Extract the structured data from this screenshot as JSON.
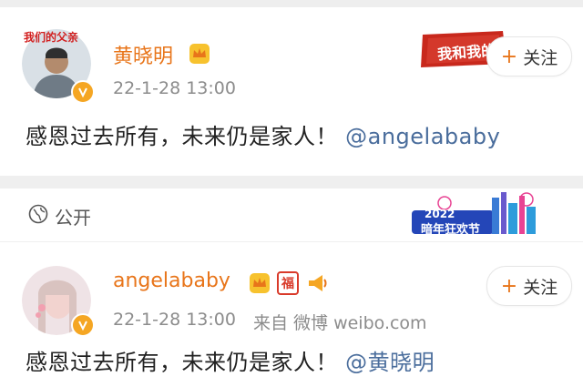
{
  "post1": {
    "avatar_caption": "我们的父亲",
    "username": "黄晓明",
    "timestamp": "22-1-28 13:00",
    "content_text": "感恩过去所有，未来仍是家人！",
    "mention": "@angelababy",
    "banner_text": "我和我的",
    "follow": {
      "plus": "+",
      "label": "关注"
    }
  },
  "visibility": {
    "label": "公开",
    "banner_year": "2022",
    "banner_text": "暗年狂欢节"
  },
  "post2": {
    "username": "angelababy",
    "tag_badge": "福",
    "timestamp": "22-1-28 13:00",
    "source": "来自 微博 weibo.com",
    "content_text": "感恩过去所有，未来仍是家人！",
    "mention": "@黄晓明",
    "follow": {
      "plus": "+",
      "label": "关注"
    }
  },
  "colors": {
    "username": "#e8751a",
    "mention": "#4a6d9c",
    "badge": "#f5a623"
  }
}
